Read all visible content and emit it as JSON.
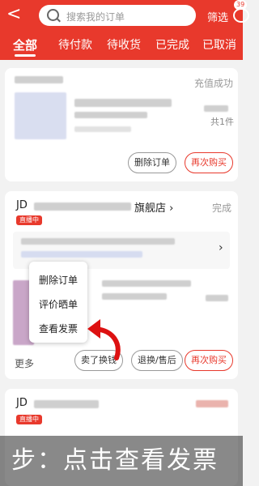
{
  "header": {
    "back_icon": "chevron-left-icon",
    "search_placeholder": "搜索我的订单",
    "filter": "筛选",
    "message_badge": "39"
  },
  "tabs": [
    {
      "label": "全部"
    },
    {
      "label": "待付款"
    },
    {
      "label": "待收货"
    },
    {
      "label": "已完成"
    },
    {
      "label": "已取消"
    }
  ],
  "orders": [
    {
      "status": "充值成功",
      "quantity": "共1件",
      "buttons": [
        "删除订单",
        "再次购买"
      ]
    },
    {
      "store": "JD",
      "store_suffix": "旗舰店 ›",
      "live": "直播中",
      "status": "完成",
      "more": "更多",
      "buttons": [
        "卖了换钱",
        "退换/售后",
        "再次购买"
      ]
    },
    {
      "store": "JD",
      "live": "直播中"
    }
  ],
  "menu": {
    "items": [
      "删除订单",
      "评价晒单",
      "查看发票"
    ]
  },
  "caption": "步：点击查看发票"
}
